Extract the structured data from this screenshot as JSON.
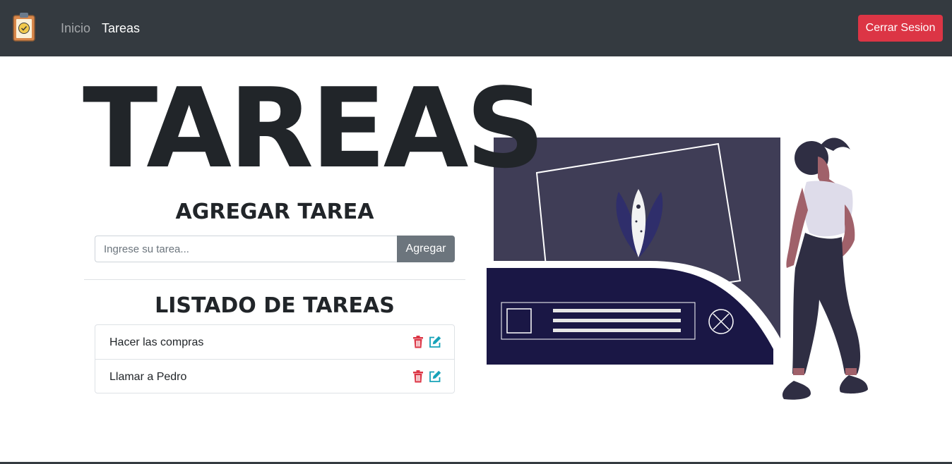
{
  "navbar": {
    "links": [
      {
        "label": "Inicio"
      },
      {
        "label": "Tareas"
      }
    ],
    "logout_label": "Cerrar Sesion"
  },
  "hero": {
    "title": "TAREAS"
  },
  "add_section": {
    "title": "AGREGAR TAREA",
    "input_placeholder": "Ingrese su tarea...",
    "input_value": "",
    "add_label": "Agregar"
  },
  "list_section": {
    "title": "LISTADO DE TAREAS",
    "tasks": [
      {
        "text": "Hacer las compras"
      },
      {
        "text": "Llamar a Pedro"
      }
    ]
  },
  "colors": {
    "navbar_bg": "#343a40",
    "danger": "#dc3545",
    "secondary": "#6c757d",
    "info": "#17a2b8",
    "dark_text": "#212529",
    "illustration_panel": "#3f3d56",
    "illustration_navy": "#1a1745"
  },
  "icons": {
    "logo": "clipboard-check-icon",
    "delete": "trash-icon",
    "edit": "edit-icon"
  }
}
